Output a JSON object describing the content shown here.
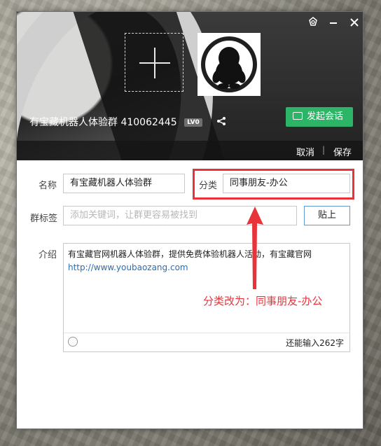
{
  "window": {
    "group_name_title": "有宝藏机器人体验群",
    "group_id": "410062445",
    "level_badge": "LV0",
    "start_chat_label": "发起会话",
    "cancel_label": "取消",
    "separator": "|",
    "save_label": "保存"
  },
  "form": {
    "name_label": "名称",
    "name_value": "有宝藏机器人体验群",
    "category_label": "分类",
    "category_value": "同事朋友-办公",
    "tags_label": "群标签",
    "tags_placeholder": "添加关键词，让群更容易被找到",
    "paste_label": "贴上",
    "intro_label": "介绍",
    "intro_line1": "有宝藏官网机器人体验群，提供免费体验机器人活动，有宝藏官网",
    "intro_link": "http://www.youbaozang.com",
    "remaining": "还能输入262字"
  },
  "annotation": {
    "text": "分类改为：同事朋友-办公",
    "color": "#e8333a"
  },
  "colors": {
    "chat_button": "#2cb566",
    "link": "#2a6db5",
    "focus_border": "#5d9ad6"
  },
  "icons": [
    "settings-icon",
    "minimize-icon",
    "close-icon",
    "share-icon",
    "chat-bubble-icon",
    "smiley-icon",
    "qq-penguin-icon",
    "add-icon"
  ]
}
